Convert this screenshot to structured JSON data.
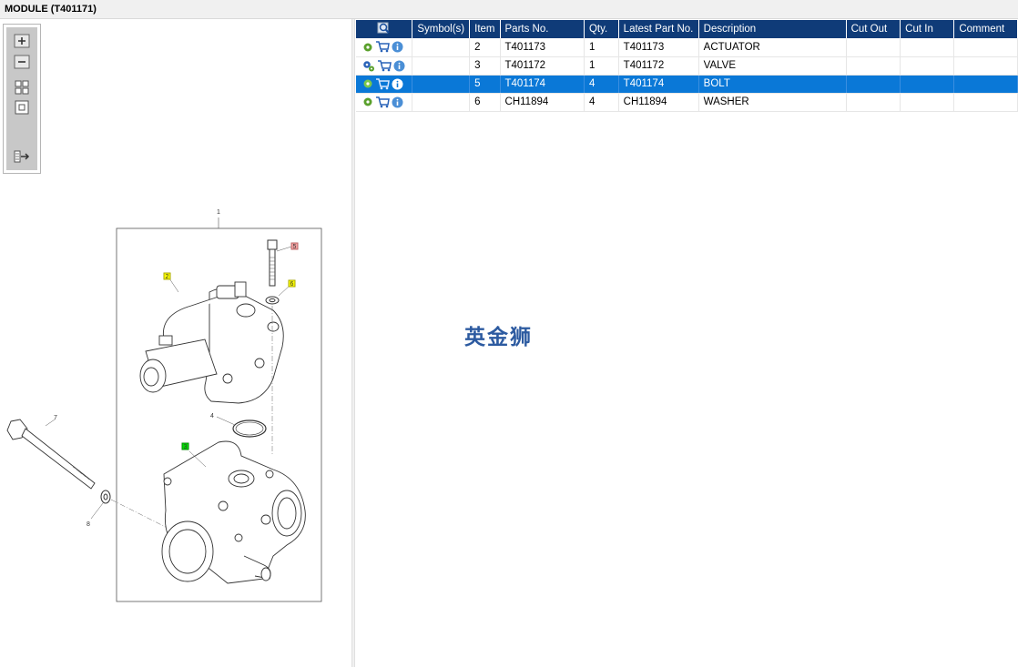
{
  "window": {
    "title": "MODULE (T401171)"
  },
  "toolbar": {
    "buttons": [
      {
        "icon": "zoom-in-icon"
      },
      {
        "icon": "zoom-out-icon"
      },
      {
        "icon": "fit-page-icon"
      },
      {
        "icon": "actual-size-icon"
      },
      {
        "icon": "export-icon"
      }
    ]
  },
  "diagram": {
    "callouts": [
      "1",
      "5",
      "2",
      "6",
      "4",
      "7",
      "3",
      "8"
    ],
    "colors": {
      "callout_1": "#f4a3a3",
      "callout_5": "#f4a3a3",
      "callout_2": "#ffff00",
      "callout_6": "#ffff00",
      "callout_3": "#00e000"
    }
  },
  "table": {
    "headers": {
      "search_icon": "search-parts-icon",
      "symbols": "Symbol(s)",
      "item": "Item",
      "parts_no": "Parts No.",
      "qty": "Qty.",
      "latest_part_no": "Latest Part No.",
      "description": "Description",
      "cut_out": "Cut Out",
      "cut_in": "Cut In",
      "comment": "Comment"
    },
    "rows": [
      {
        "item": "2",
        "parts_no": "T401173",
        "qty": "1",
        "latest_part_no": "T401173",
        "description": "ACTUATOR",
        "cut_out": "",
        "cut_in": "",
        "comment": "",
        "symbols": "",
        "selected": false
      },
      {
        "item": "3",
        "parts_no": "T401172",
        "qty": "1",
        "latest_part_no": "T401172",
        "description": "VALVE",
        "cut_out": "",
        "cut_in": "",
        "comment": "",
        "symbols": "",
        "selected": false
      },
      {
        "item": "5",
        "parts_no": "T401174",
        "qty": "4",
        "latest_part_no": "T401174",
        "description": "BOLT",
        "cut_out": "",
        "cut_in": "",
        "comment": "",
        "symbols": "",
        "selected": true
      },
      {
        "item": "6",
        "parts_no": "CH11894",
        "qty": "4",
        "latest_part_no": "CH11894",
        "description": "WASHER",
        "cut_out": "",
        "cut_in": "",
        "comment": "",
        "symbols": "",
        "selected": false
      }
    ],
    "header_bg": "#0f3b78",
    "selected_bg": "#0a78d7"
  },
  "watermark": {
    "text": "英金狮"
  }
}
